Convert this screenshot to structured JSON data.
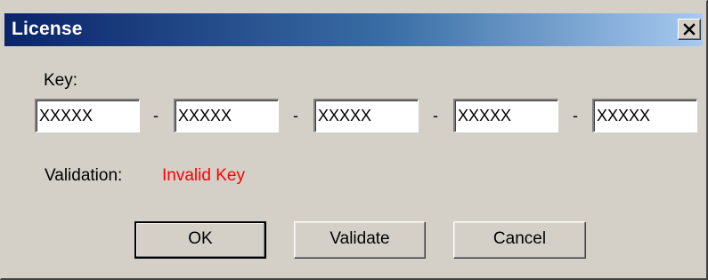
{
  "window": {
    "title": "License"
  },
  "form": {
    "key_label": "Key:",
    "key_separator": "-",
    "key_fields": [
      "XXXXX",
      "XXXXX",
      "XXXXX",
      "XXXXX",
      "XXXXX"
    ],
    "validation_label": "Validation:",
    "validation_value": "Invalid Key",
    "validation_color": "#ff0000"
  },
  "buttons": {
    "ok_label": "OK",
    "validate_label": "Validate",
    "cancel_label": "Cancel"
  },
  "colors": {
    "titlebar_start": "#0a246a",
    "titlebar_end": "#a6caf0",
    "window_bg": "#d4d0c8"
  },
  "icons": {
    "close": "close-icon"
  }
}
